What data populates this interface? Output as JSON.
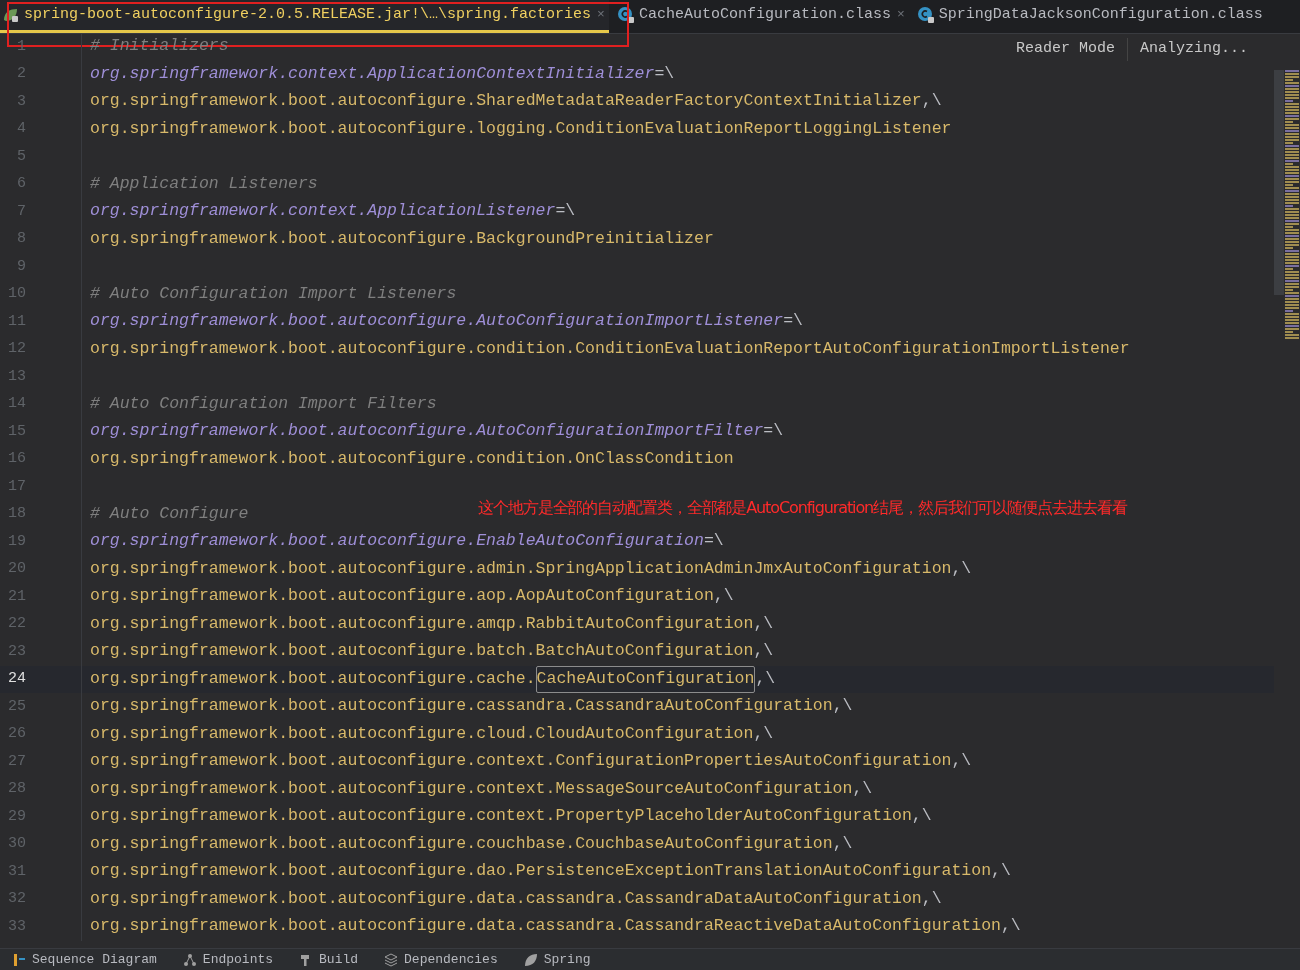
{
  "tabs": [
    {
      "label": "spring-boot-autoconfigure-2.0.5.RELEASE.jar!\\…\\spring.factories",
      "kind": "factories",
      "selected": true,
      "close": "×"
    },
    {
      "label": "CacheAutoConfiguration.class",
      "kind": "class",
      "selected": false,
      "close": "×"
    },
    {
      "label": "SpringDataJacksonConfiguration.class",
      "kind": "class",
      "selected": false
    }
  ],
  "editor_actions": [
    "Reader Mode",
    "Analyzing..."
  ],
  "annotation": "这个地方是全部的自动配置类，全部都是AutoConfiguration结尾，然后我们可以随便点去进去看看",
  "lines": [
    {
      "number": "1",
      "kind": "comment",
      "text": "# Initializers",
      "current": false
    },
    {
      "number": "2",
      "kind": "key",
      "text": "org.springframework.context.ApplicationContextInitializer",
      "tail": "=\\",
      "current": false
    },
    {
      "number": "3",
      "kind": "value",
      "text": "org.springframework.boot.autoconfigure.SharedMetadataReaderFactoryContextInitializer",
      "tail": ",\\",
      "current": false
    },
    {
      "number": "4",
      "kind": "value",
      "text": "org.springframework.boot.autoconfigure.logging.ConditionEvaluationReportLoggingListener",
      "current": false
    },
    {
      "number": "5",
      "kind": "blank",
      "current": false
    },
    {
      "number": "6",
      "kind": "comment",
      "text": "# Application Listeners",
      "current": false
    },
    {
      "number": "7",
      "kind": "key",
      "text": "org.springframework.context.ApplicationListener",
      "tail": "=\\",
      "current": false
    },
    {
      "number": "8",
      "kind": "value",
      "text": "org.springframework.boot.autoconfigure.BackgroundPreinitializer",
      "current": false
    },
    {
      "number": "9",
      "kind": "blank",
      "current": false
    },
    {
      "number": "10",
      "kind": "comment",
      "text": "# Auto Configuration Import Listeners",
      "current": false
    },
    {
      "number": "11",
      "kind": "key",
      "text": "org.springframework.boot.autoconfigure.AutoConfigurationImportListener",
      "tail": "=\\",
      "current": false
    },
    {
      "number": "12",
      "kind": "value",
      "text": "org.springframework.boot.autoconfigure.condition.ConditionEvaluationReportAutoConfigurationImportListener",
      "current": false
    },
    {
      "number": "13",
      "kind": "blank",
      "current": false
    },
    {
      "number": "14",
      "kind": "comment",
      "text": "# Auto Configuration Import Filters",
      "current": false
    },
    {
      "number": "15",
      "kind": "key",
      "text": "org.springframework.boot.autoconfigure.AutoConfigurationImportFilter",
      "tail": "=\\",
      "current": false
    },
    {
      "number": "16",
      "kind": "value",
      "text": "org.springframework.boot.autoconfigure.condition.OnClassCondition",
      "current": false
    },
    {
      "number": "17",
      "kind": "blank",
      "current": false
    },
    {
      "number": "18",
      "kind": "comment",
      "text": "# Auto Configure",
      "current": false
    },
    {
      "number": "19",
      "kind": "key",
      "text": "org.springframework.boot.autoconfigure.EnableAutoConfiguration",
      "tail": "=\\",
      "current": false
    },
    {
      "number": "20",
      "kind": "value",
      "text": "org.springframework.boot.autoconfigure.admin.SpringApplicationAdminJmxAutoConfiguration",
      "tail": ",\\",
      "current": false
    },
    {
      "number": "21",
      "kind": "value",
      "text": "org.springframework.boot.autoconfigure.aop.AopAutoConfiguration",
      "tail": ",\\",
      "current": false
    },
    {
      "number": "22",
      "kind": "value",
      "text": "org.springframework.boot.autoconfigure.amqp.RabbitAutoConfiguration",
      "tail": ",\\",
      "current": false
    },
    {
      "number": "23",
      "kind": "value",
      "text": "org.springframework.boot.autoconfigure.batch.BatchAutoConfiguration",
      "tail": ",\\",
      "current": false
    },
    {
      "number": "24",
      "kind": "value",
      "text": "org.springframework.boot.autoconfigure.cache.",
      "selection": "CacheAutoConfiguration",
      "tail": ",\\",
      "current": true
    },
    {
      "number": "25",
      "kind": "value",
      "text": "org.springframework.boot.autoconfigure.cassandra.CassandraAutoConfiguration",
      "tail": ",\\",
      "current": false
    },
    {
      "number": "26",
      "kind": "value",
      "text": "org.springframework.boot.autoconfigure.cloud.CloudAutoConfiguration",
      "tail": ",\\",
      "current": false
    },
    {
      "number": "27",
      "kind": "value",
      "text": "org.springframework.boot.autoconfigure.context.ConfigurationPropertiesAutoConfiguration",
      "tail": ",\\",
      "current": false
    },
    {
      "number": "28",
      "kind": "value",
      "text": "org.springframework.boot.autoconfigure.context.MessageSourceAutoConfiguration",
      "tail": ",\\",
      "current": false
    },
    {
      "number": "29",
      "kind": "value",
      "text": "org.springframework.boot.autoconfigure.context.PropertyPlaceholderAutoConfiguration",
      "tail": ",\\",
      "current": false
    },
    {
      "number": "30",
      "kind": "value",
      "text": "org.springframework.boot.autoconfigure.couchbase.CouchbaseAutoConfiguration",
      "tail": ",\\",
      "current": false
    },
    {
      "number": "31",
      "kind": "value",
      "text": "org.springframework.boot.autoconfigure.dao.PersistenceExceptionTranslationAutoConfiguration",
      "tail": ",\\",
      "current": false
    },
    {
      "number": "32",
      "kind": "value",
      "text": "org.springframework.boot.autoconfigure.data.cassandra.CassandraDataAutoConfiguration",
      "tail": ",\\",
      "current": false
    },
    {
      "number": "33",
      "kind": "value",
      "text": "org.springframework.boot.autoconfigure.data.cassandra.CassandraReactiveDataAutoConfiguration",
      "tail": ",\\",
      "current": false
    }
  ],
  "tool_windows": [
    {
      "label": "Sequence Diagram",
      "kind": "sequence"
    },
    {
      "label": "Endpoints",
      "kind": "endpoints"
    },
    {
      "label": "Build",
      "kind": "build"
    },
    {
      "label": "Dependencies",
      "kind": "dependencies"
    },
    {
      "label": "Spring",
      "kind": "spring"
    }
  ]
}
